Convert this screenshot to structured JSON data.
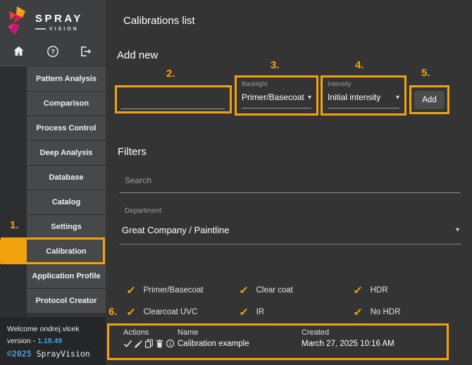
{
  "brand": {
    "name_top": "SPRAY",
    "name_bottom": "VISION"
  },
  "sidebar": {
    "items": [
      "Pattern Analysis",
      "Comparison",
      "Process Control",
      "Deep Analysis",
      "Database",
      "Catalog",
      "Settings",
      "Calibration",
      "Application Profile",
      "Protocol Creator"
    ],
    "selected": "Calibration"
  },
  "footer": {
    "welcome": "Welcome ondrej.vlcek",
    "version_label": "version -",
    "version_value": "1.18.49",
    "copyright": "©2025",
    "company": "SprayVision"
  },
  "page": {
    "title": "Calibrations list"
  },
  "add_new": {
    "title": "Add new",
    "name_value": "",
    "backlight_label": "Backlight",
    "backlight_value": "Primer/Basecoat",
    "intensity_label": "Intensity",
    "intensity_value": "Initial intensity",
    "add_button": "Add"
  },
  "filters": {
    "title": "Filters",
    "search_placeholder": "Search",
    "department_label": "Department",
    "department_value": "Great Company / Paintline",
    "options": [
      "Primer/Basecoat",
      "Clear coat",
      "HDR",
      "Clearcoat UVC",
      "IR",
      "No HDR"
    ]
  },
  "table": {
    "headers": [
      "Actions",
      "Name",
      "Created"
    ],
    "rows": [
      {
        "name": "Calibration example",
        "created": "March 27, 2025 10:16 AM"
      }
    ]
  },
  "annotations": [
    "1.",
    "2.",
    "3.",
    "4.",
    "5.",
    "6."
  ],
  "icons": {
    "caret": "▾",
    "check": "✓"
  },
  "colors": {
    "accent": "#F2A20E",
    "link": "#41A4DC"
  }
}
